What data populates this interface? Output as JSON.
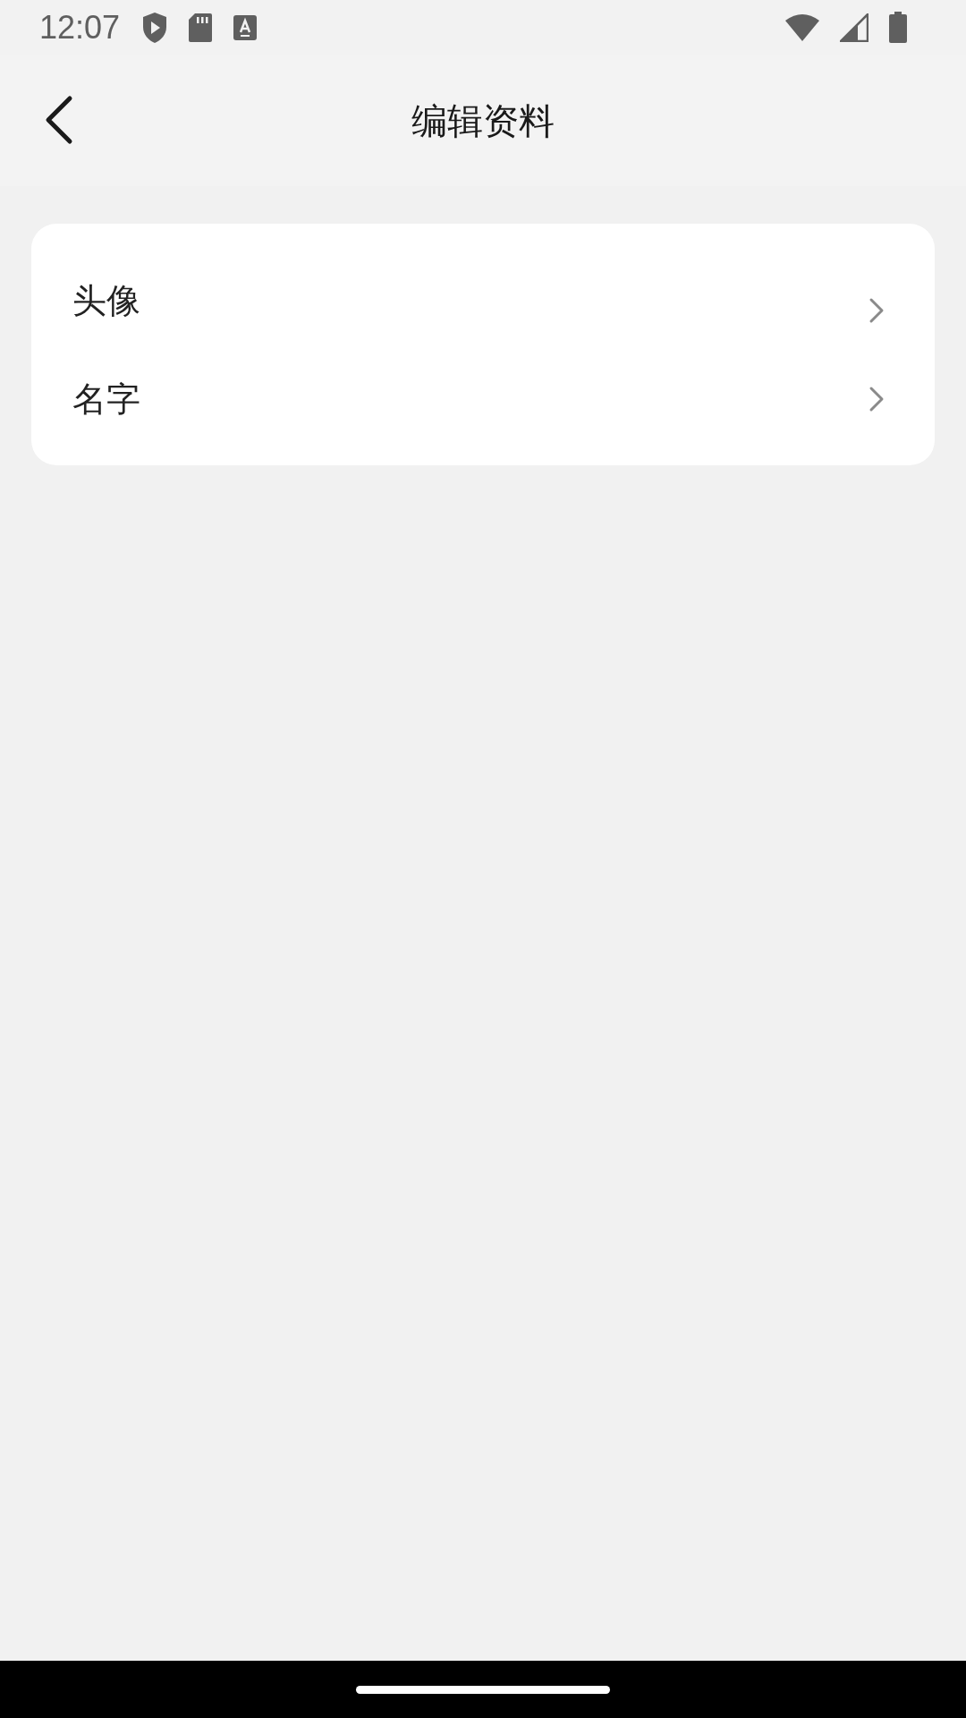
{
  "status_bar": {
    "time": "12:07"
  },
  "header": {
    "title": "编辑资料"
  },
  "menu": [
    {
      "label": "头像"
    },
    {
      "label": "名字"
    }
  ]
}
